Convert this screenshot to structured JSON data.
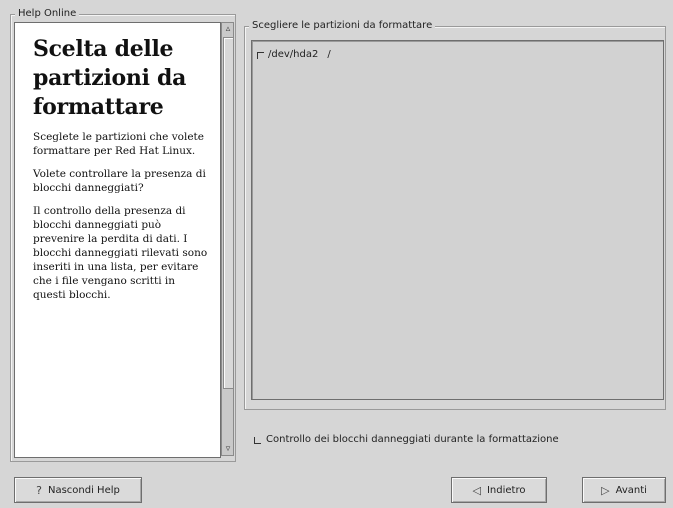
{
  "help_panel": {
    "frame_title": "Help Online",
    "heading": "Scelta delle partizioni da formattare",
    "paragraphs": [
      "Sceglete le partizioni che volete formattare per Red Hat Linux.",
      "Volete controllare la presenza di blocchi danneggiati?",
      "Il controllo della presenza di blocchi danneggiati può prevenire la perdita di dati. I blocchi danneggiati rilevati sono inseriti in una lista, per evitare che i file vengano scritti in questi blocchi."
    ]
  },
  "partitions": {
    "frame_title": "Scegliere le partizioni da formattare",
    "items": [
      {
        "device": "/dev/hda2",
        "mount": "/",
        "checked": false
      }
    ]
  },
  "badblocks_option": {
    "label": "Controllo dei blocchi danneggiati durante la formattazione",
    "checked": false
  },
  "buttons": {
    "hide_help": {
      "label": "Nascondi Help",
      "icon": "question-icon"
    },
    "back": {
      "label": "Indietro",
      "icon": "arrow-left-icon"
    },
    "next": {
      "label": "Avanti",
      "icon": "arrow-right-icon"
    }
  }
}
